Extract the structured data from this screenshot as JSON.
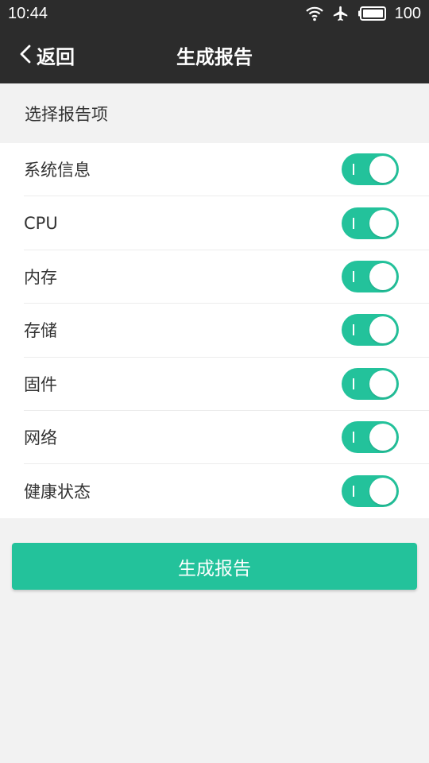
{
  "status_bar": {
    "time": "10:44",
    "battery": "100",
    "icons": [
      "wifi-icon",
      "airplane-icon",
      "battery-icon"
    ]
  },
  "header": {
    "back_label": "返回",
    "title": "生成报告"
  },
  "section": {
    "title": "选择报告项"
  },
  "items": [
    {
      "label": "系统信息",
      "enabled": true
    },
    {
      "label": "CPU",
      "enabled": true
    },
    {
      "label": "内存",
      "enabled": true
    },
    {
      "label": "存储",
      "enabled": true
    },
    {
      "label": "固件",
      "enabled": true
    },
    {
      "label": "网络",
      "enabled": true
    },
    {
      "label": "健康状态",
      "enabled": true
    }
  ],
  "actions": {
    "generate_label": "生成报告"
  },
  "colors": {
    "accent": "#23c29b",
    "header_bg": "#2c2c2c",
    "page_bg": "#f2f2f2"
  }
}
